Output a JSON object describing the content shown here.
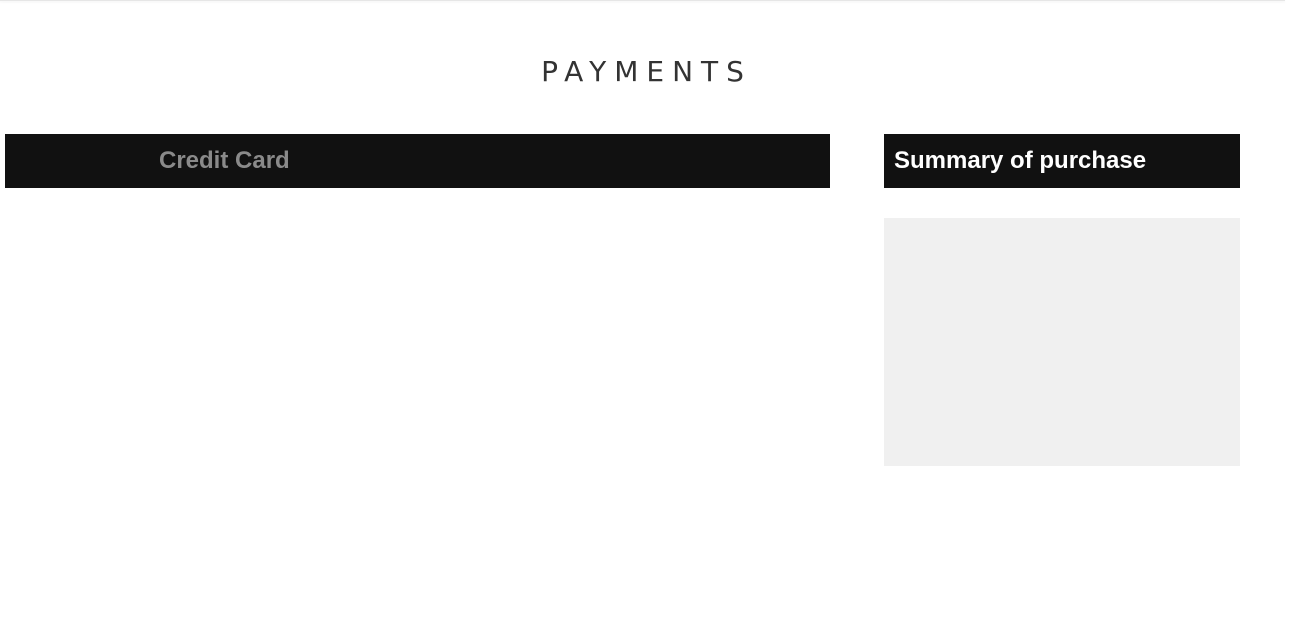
{
  "page": {
    "title": "PAYMENTS"
  },
  "payment_tabs": {
    "items": [
      {
        "label": "Credit Card"
      }
    ]
  },
  "summary": {
    "title": "Summary of purchase"
  },
  "colors": {
    "header_bg": "#111111",
    "tab_text_inactive": "#8a8a8a",
    "summary_body_bg": "#f0f0f0",
    "title_text": "#333333"
  }
}
